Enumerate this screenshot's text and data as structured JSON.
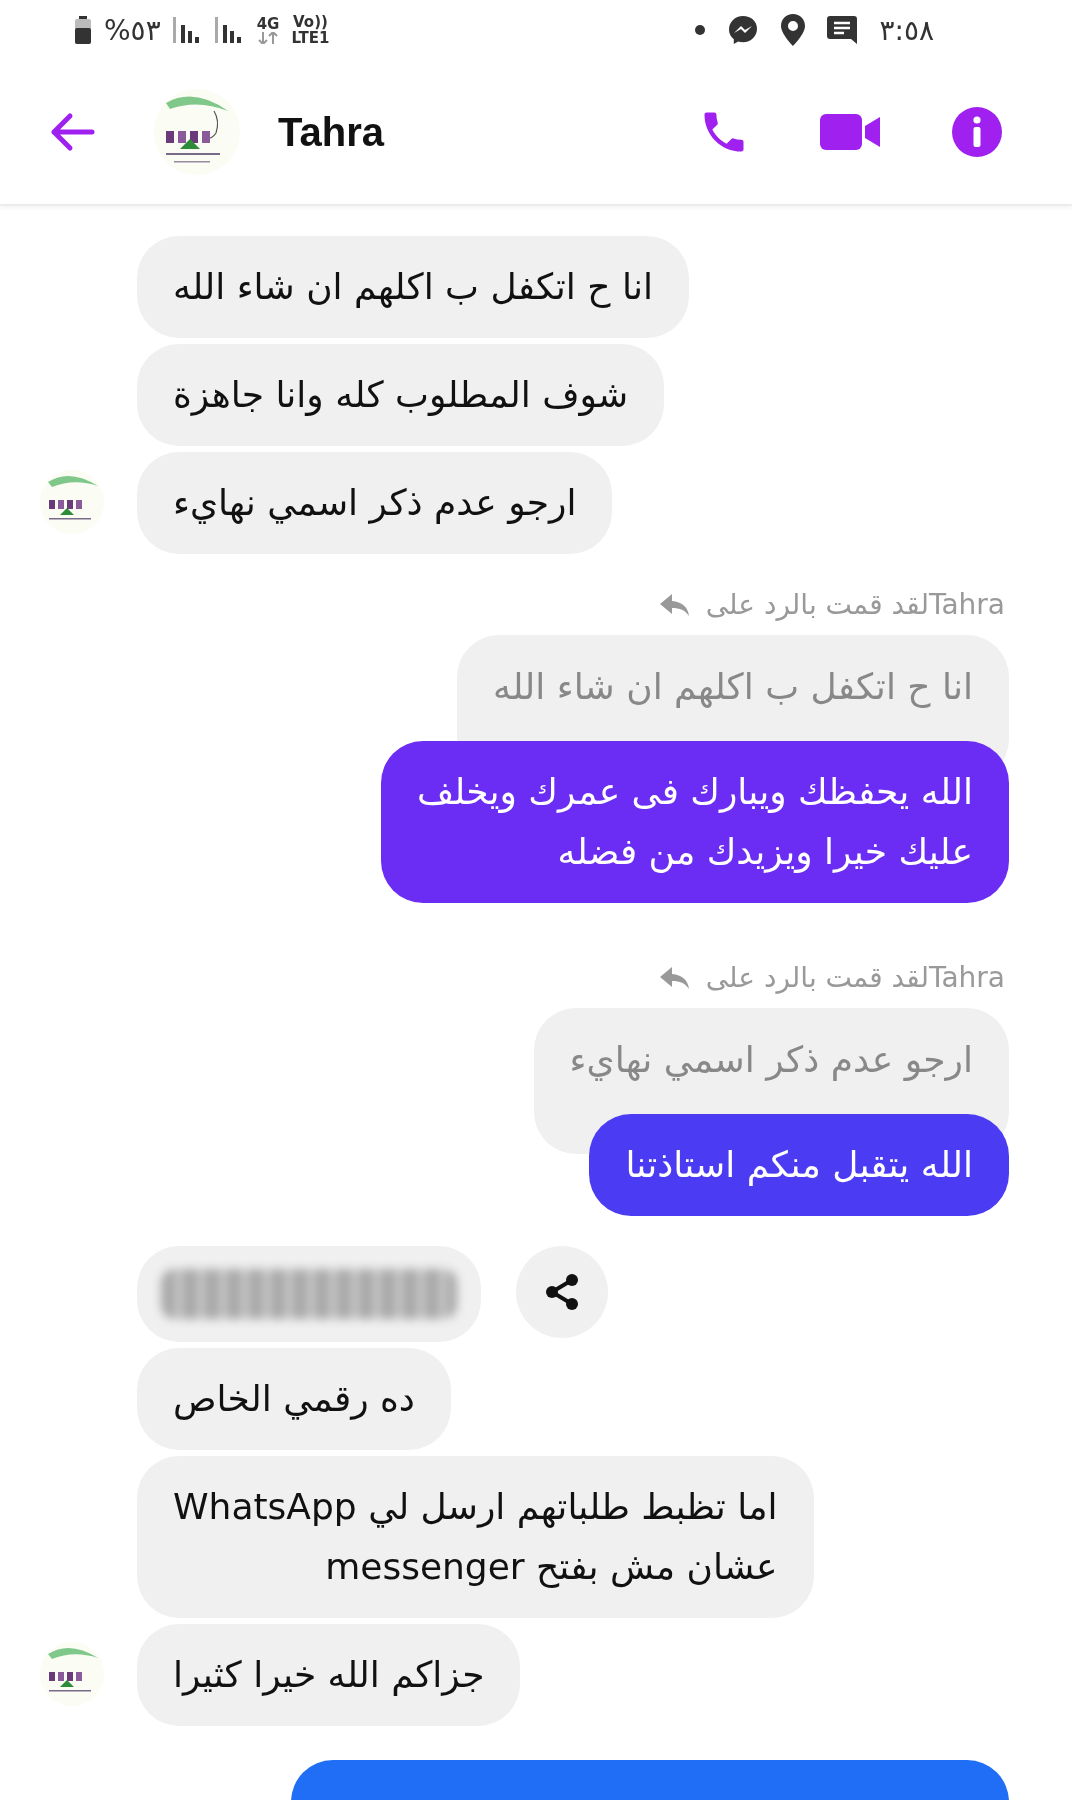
{
  "status_bar": {
    "battery": "%٥٣",
    "network": "4G",
    "volte": "Vo))",
    "lte": "LTE1",
    "time": "٣:٥٨"
  },
  "header": {
    "name": "Tahra"
  },
  "messages": [
    {
      "kind": "incoming-text",
      "text": "انا ح اتكفل ب اكلهم ان شاء الله",
      "avatar": false
    },
    {
      "kind": "incoming-text",
      "text": "شوف المطلوب كله وانا جاهزة",
      "avatar": false
    },
    {
      "kind": "incoming-text",
      "text": "ارجو عدم ذكر اسمي نهايء",
      "avatar": true
    },
    {
      "kind": "outgoing-reply",
      "reply_label": "Tahraلقد قمت بالرد على",
      "quoted": "انا ح اتكفل ب اكلهم ان شاء الله",
      "text": "الله يحفظك ويبارك فى عمرك ويخلف\nعليك خيرا ويزيدك من فضله",
      "color": "#6b2df3"
    },
    {
      "kind": "outgoing-reply",
      "reply_label": "Tahraلقد قمت بالرد على",
      "quoted": "ارجو عدم ذكر اسمي نهايء",
      "text": "الله يتقبل منكم استاذتنا",
      "color": "#4b3cf4"
    },
    {
      "kind": "incoming-redacted",
      "avatar": false
    },
    {
      "kind": "incoming-text",
      "text": "ده رقمي الخاص",
      "avatar": false
    },
    {
      "kind": "incoming-text",
      "text": "اما تظبط طلباتهم ارسل لي WhatsApp\nعشان مش بفتح messenger",
      "avatar": false
    },
    {
      "kind": "incoming-text",
      "text": "جزاكم الله خيرا كثيرا",
      "avatar": true
    },
    {
      "kind": "outgoing-clipped",
      "color": "#1f6ef5"
    }
  ]
}
